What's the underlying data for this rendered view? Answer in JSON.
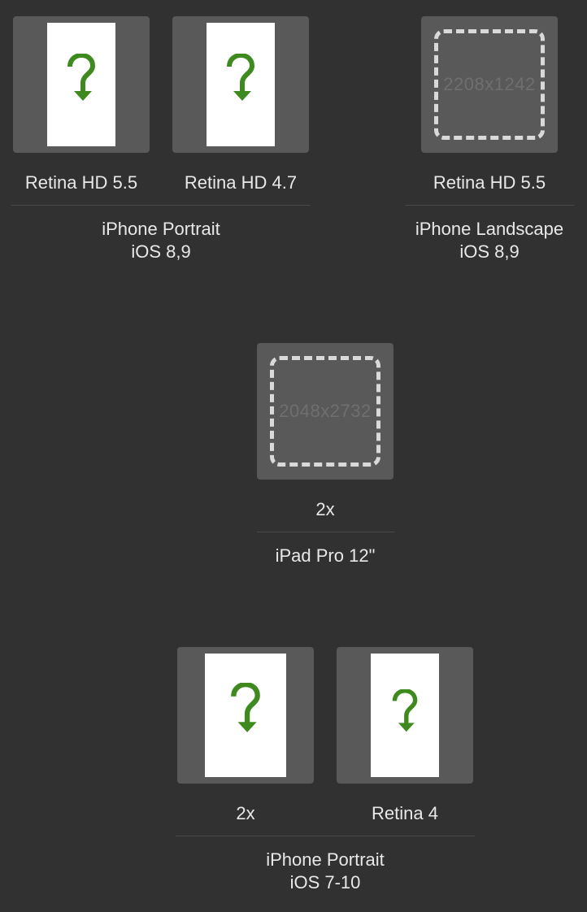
{
  "groups": [
    {
      "slots": [
        {
          "label": "Retina HD 5.5",
          "state": "missing-image"
        },
        {
          "label": "Retina HD 4.7",
          "state": "missing-image"
        }
      ],
      "title": "iPhone Portrait",
      "subtitle": "iOS 8,9"
    },
    {
      "slots": [
        {
          "label": "Retina HD 5.5",
          "state": "empty",
          "size_hint": "2208x1242"
        }
      ],
      "title": "iPhone Landscape",
      "subtitle": "iOS 8,9"
    },
    {
      "slots": [
        {
          "label": "2x",
          "state": "empty",
          "size_hint": "2048x2732"
        }
      ],
      "title": "iPad Pro 12\""
    },
    {
      "slots": [
        {
          "label": "2x",
          "state": "missing-image"
        },
        {
          "label": "Retina 4",
          "state": "missing-image"
        }
      ],
      "title": "iPhone Portrait",
      "subtitle": "iOS 7-10"
    }
  ],
  "colors": {
    "background": "#313131",
    "well": "#595959",
    "placeholder_icon": "#3f8a1f",
    "dashed_border": "#d9d9d9"
  },
  "icons": {
    "missing_image": "question-arrow-icon"
  }
}
